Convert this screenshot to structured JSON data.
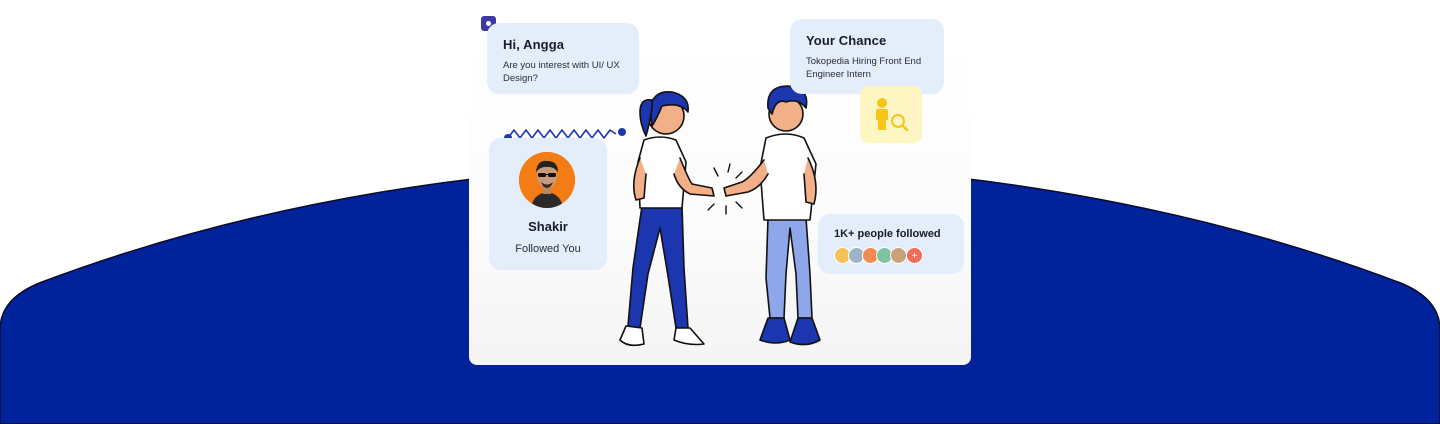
{
  "colors": {
    "dome_blue": "#00239c",
    "bubble_bg": "#e4eefb",
    "accent_purple": "#3d3aa3",
    "avatar_orange": "#f47c14",
    "badge_yellow": "#fdf6c3",
    "plus_red": "#f26c5a"
  },
  "greeting": {
    "title": "Hi, Angga",
    "message": "Are you interest with UI/ UX Design?"
  },
  "chance": {
    "title": "Your Chance",
    "message": "Tokopedia  Hiring Front End Engineer Intern",
    "icon": "job-search-icon"
  },
  "follow": {
    "name": "Shakir",
    "status": "Followed You",
    "icon": "avatar-photo"
  },
  "people": {
    "title": "1K+ people followed",
    "more_label": "+",
    "avatar_colors": [
      "#f3c25a",
      "#9fb3c8",
      "#f28b52",
      "#7fc3a2",
      "#c9a27a",
      "#5b6bd6"
    ]
  },
  "illustration": {
    "icon": "handshake-illustration"
  }
}
